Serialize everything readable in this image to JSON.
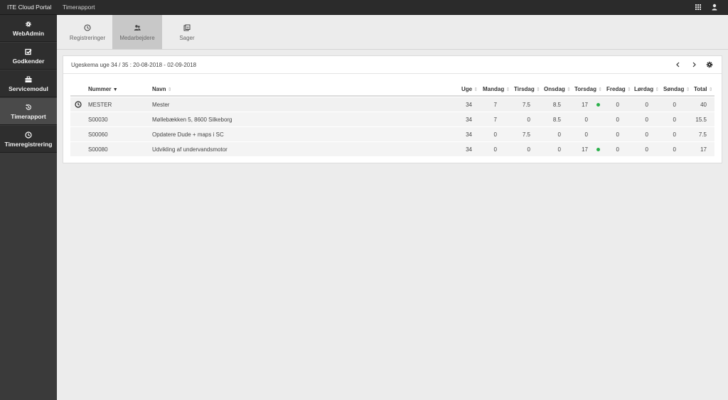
{
  "topbar": {
    "brand": "ITE Cloud Portal",
    "crumb": "Timerapport"
  },
  "sidebar": {
    "items": [
      {
        "label": "WebAdmin",
        "icon": "gear-icon"
      },
      {
        "label": "Godkender",
        "icon": "checkbox-icon"
      },
      {
        "label": "Servicemodul",
        "icon": "toolbox-icon"
      },
      {
        "label": "Timerapport",
        "icon": "history-icon"
      },
      {
        "label": "Timeregistrering",
        "icon": "clock-icon"
      }
    ],
    "active": "Timerapport"
  },
  "tabs": [
    {
      "label": "Registreringer",
      "icon": "clock-icon"
    },
    {
      "label": "Medarbejdere",
      "icon": "employees-icon"
    },
    {
      "label": "Sager",
      "icon": "cases-icon"
    }
  ],
  "active_tab": "Medarbejdere",
  "panel": {
    "title": "Ugeskema uge 34 / 35 : 20-08-2018 - 02-09-2018"
  },
  "table": {
    "headers": {
      "nummer": "Nummer",
      "navn": "Navn",
      "uge": "Uge",
      "mandag": "Mandag",
      "tirsdag": "Tirsdag",
      "onsdag": "Onsdag",
      "torsdag": "Torsdag",
      "fredag": "Fredag",
      "lordag": "Lørdag",
      "sondag": "Søndag",
      "total": "Total"
    },
    "rows": [
      {
        "nummer": "MESTER",
        "navn": "Mester",
        "uge": "34",
        "mandag": "7",
        "tirsdag": "7.5",
        "onsdag": "8.5",
        "torsdag": "17",
        "fredag": "0",
        "lordag": "0",
        "sondag": "0",
        "total": "40"
      },
      {
        "nummer": "S00030",
        "navn": "Møllebækken 5, 8600 Silkeborg",
        "uge": "34",
        "mandag": "7",
        "tirsdag": "0",
        "onsdag": "8.5",
        "torsdag": "0",
        "fredag": "0",
        "lordag": "0",
        "sondag": "0",
        "total": "15.5"
      },
      {
        "nummer": "S00060",
        "navn": "Opdatere Dude + maps i SC",
        "uge": "34",
        "mandag": "0",
        "tirsdag": "7.5",
        "onsdag": "0",
        "torsdag": "0",
        "fredag": "0",
        "lordag": "0",
        "sondag": "0",
        "total": "7.5"
      },
      {
        "nummer": "S00080",
        "navn": "Udvikling af undervandsmotor",
        "uge": "34",
        "mandag": "0",
        "tirsdag": "0",
        "onsdag": "0",
        "torsdag": "17",
        "fredag": "0",
        "lordag": "0",
        "sondag": "0",
        "total": "17"
      }
    ]
  },
  "colors": {
    "status_dot": "#2ab04a",
    "topbar": "#2b2b2b",
    "sidebar": "#2e2e2e"
  }
}
